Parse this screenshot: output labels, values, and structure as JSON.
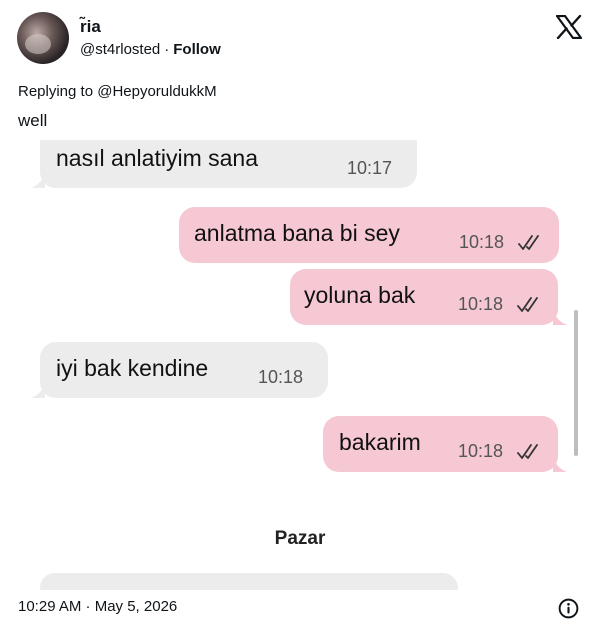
{
  "tweet": {
    "author_name": "r̃ia",
    "handle": "@st4rlosted",
    "separator": "·",
    "follow_label": "Follow",
    "replying_to": "Replying to @HepyoruldukkM",
    "text": "well",
    "timestamp": "10:29 AM · May 5, 2026"
  },
  "icons": {
    "logo": "x-logo-icon",
    "info": "info-icon",
    "read_receipt": "double-check-icon"
  },
  "chat": {
    "messages": [
      {
        "direction": "in",
        "text": "nasıl anlatiyim sana",
        "time": "10:17"
      },
      {
        "direction": "out",
        "text": "anlatma bana bi sey",
        "time": "10:18"
      },
      {
        "direction": "out",
        "text": "yoluna bak",
        "time": "10:18"
      },
      {
        "direction": "in",
        "text": "iyi bak kendine",
        "time": "10:18"
      },
      {
        "direction": "out",
        "text": "bakarim",
        "time": "10:18"
      }
    ],
    "day_separator": "Pazar"
  },
  "colors": {
    "incoming_bubble": "#ececec",
    "outgoing_bubble": "#f6c8d3"
  }
}
